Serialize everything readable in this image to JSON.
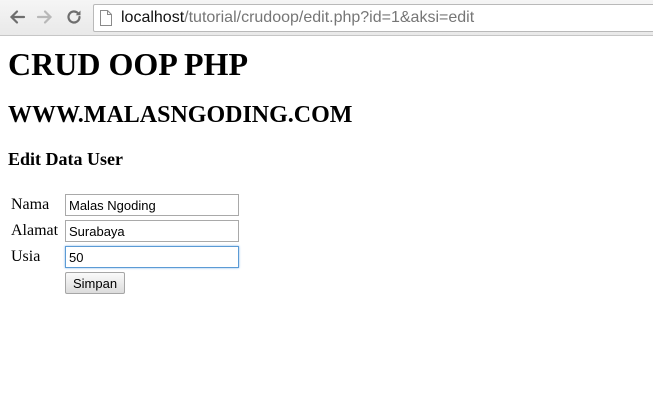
{
  "browser": {
    "url_host": "localhost",
    "url_rest": "/tutorial/crudoop/edit.php?id=1&aksi=edit",
    "back_icon": "arrow-left-icon",
    "forward_icon": "arrow-right-icon",
    "reload_icon": "reload-icon",
    "page_icon": "page-icon"
  },
  "page": {
    "title": "CRUD OOP PHP",
    "site": "WWW.MALASNGODING.COM",
    "section": "Edit Data User"
  },
  "form": {
    "nama_label": "Nama",
    "nama_value": "Malas Ngoding",
    "alamat_label": "Alamat",
    "alamat_value": "Surabaya",
    "usia_label": "Usia",
    "usia_value": "50",
    "submit_label": "Simpan"
  }
}
